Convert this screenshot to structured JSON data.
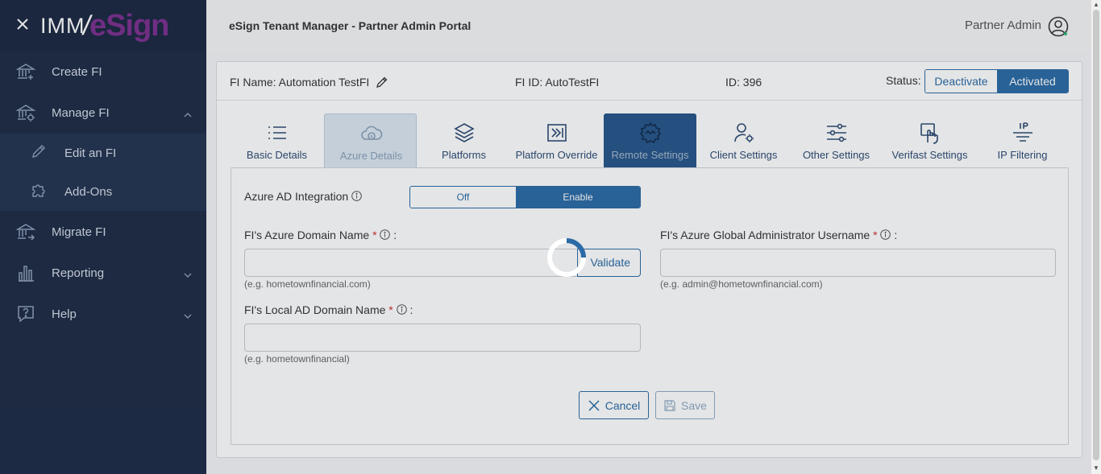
{
  "sidebar": {
    "logo": {
      "part1": "IMM",
      "part2": "eSign"
    },
    "items": [
      {
        "label": "Create FI",
        "icon": "bank-add-icon"
      },
      {
        "label": "Manage FI",
        "icon": "bank-gear-icon",
        "expanded": true
      },
      {
        "label": "Edit an FI",
        "icon": "pencil-icon",
        "sub": true
      },
      {
        "label": "Add-Ons",
        "icon": "puzzle-icon",
        "sub": true
      },
      {
        "label": "Migrate FI",
        "icon": "bank-arrow-icon"
      },
      {
        "label": "Reporting",
        "icon": "bar-chart-icon",
        "expandable": true
      },
      {
        "label": "Help",
        "icon": "help-bubble-icon",
        "expandable": true
      }
    ]
  },
  "header": {
    "title": "eSign Tenant Manager - Partner Admin Portal",
    "user": "Partner Admin"
  },
  "fi": {
    "name_label": "FI Name: Automation TestFI",
    "id_label": "FI ID: AutoTestFI",
    "num_label": "ID: 396",
    "status_label": "Status:",
    "deactivate": "Deactivate",
    "activated": "Activated"
  },
  "tabs": [
    {
      "label": "Basic Details",
      "icon": "list-icon"
    },
    {
      "label": "Azure Details",
      "icon": "cloud-info-icon",
      "state": "active"
    },
    {
      "label": "Platforms",
      "icon": "layers-icon"
    },
    {
      "label": "Platform Override",
      "icon": "override-icon"
    },
    {
      "label": "Remote Settings",
      "icon": "remote-gear-icon",
      "state": "hilite"
    },
    {
      "label": "Client Settings",
      "icon": "user-gear-icon"
    },
    {
      "label": "Other Settings",
      "icon": "sliders-icon"
    },
    {
      "label": "Verifast Settings",
      "icon": "hand-touch-icon"
    },
    {
      "label": "IP Filtering",
      "icon": "ip-filter-icon"
    }
  ],
  "form": {
    "azure_ad_label": "Azure AD Integration",
    "toggle_off": "Off",
    "toggle_on": "Enable",
    "domain_label": "FI's Azure Domain Name",
    "domain_value": "",
    "domain_hint": "(e.g. hometownfinancial.com)",
    "validate": "Validate",
    "admin_label": "FI's Azure Global Administrator Username",
    "admin_value": "",
    "admin_hint": "(e.g. admin@hometownfinancial.com)",
    "local_label": "FI's Local AD Domain Name",
    "local_value": "",
    "local_hint": "(e.g. hometownfinancial)",
    "required_mark": "*",
    "colon": ":",
    "cancel": "Cancel",
    "save": "Save"
  },
  "colors": {
    "sidebar_bg": "#1d2b45",
    "accent": "#2a6aa6",
    "tab_hilite": "#25558a",
    "logo_accent": "#7c2f8f"
  }
}
